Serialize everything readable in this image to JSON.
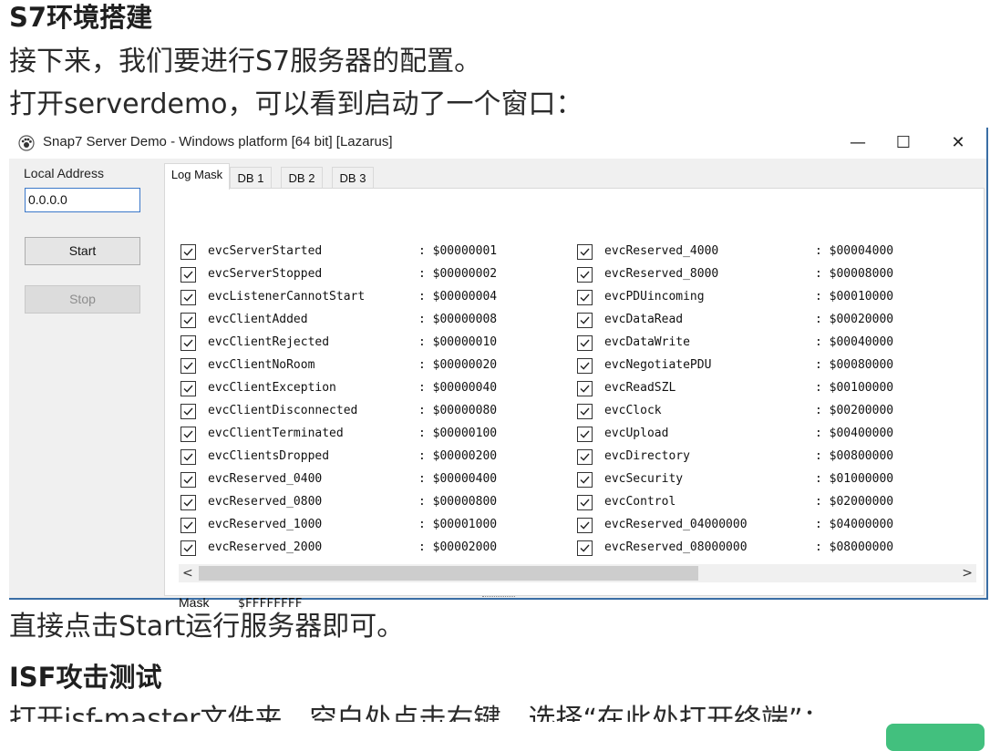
{
  "article": {
    "heading1": "S7环境搭建",
    "para1": "接下来，我们要进行S7服务器的配置。",
    "para2": "打开serverdemo，可以看到启动了一个窗口：",
    "para3": "直接点击Start运行服务器即可。",
    "heading2": "ISF攻击测试",
    "para4": "打开isf-master文件夹，空白处点击右键，选择“在此处打开终端”："
  },
  "window": {
    "title": "Snap7 Server Demo - Windows platform [64 bit] [Lazarus]",
    "minimize": "—",
    "maximize": "☐",
    "close": "✕"
  },
  "left_panel": {
    "address_label": "Local Address",
    "address_value": "0.0.0.0",
    "start_label": "Start",
    "stop_label": "Stop"
  },
  "tabs": [
    {
      "label": "Log Mask",
      "active": true
    },
    {
      "label": "DB 1",
      "active": false
    },
    {
      "label": "DB 2",
      "active": false
    },
    {
      "label": "DB 3",
      "active": false
    }
  ],
  "left_events": [
    {
      "name": "evcServerStarted",
      "value": ": $00000001",
      "checked": true
    },
    {
      "name": "evcServerStopped",
      "value": ": $00000002",
      "checked": true
    },
    {
      "name": "evcListenerCannotStart",
      "value": ": $00000004",
      "checked": true
    },
    {
      "name": "evcClientAdded",
      "value": ": $00000008",
      "checked": true
    },
    {
      "name": "evcClientRejected",
      "value": ": $00000010",
      "checked": true
    },
    {
      "name": "evcClientNoRoom",
      "value": ": $00000020",
      "checked": true
    },
    {
      "name": "evcClientException",
      "value": ": $00000040",
      "checked": true
    },
    {
      "name": "evcClientDisconnected",
      "value": ": $00000080",
      "checked": true
    },
    {
      "name": "evcClientTerminated",
      "value": ": $00000100",
      "checked": true
    },
    {
      "name": "evcClientsDropped",
      "value": ": $00000200",
      "checked": true
    },
    {
      "name": "evcReserved_0400",
      "value": ": $00000400",
      "checked": true
    },
    {
      "name": "evcReserved_0800",
      "value": ": $00000800",
      "checked": true
    },
    {
      "name": "evcReserved_1000",
      "value": ": $00001000",
      "checked": true
    },
    {
      "name": "evcReserved_2000",
      "value": ": $00002000",
      "checked": true
    }
  ],
  "right_events": [
    {
      "name": "evcReserved_4000",
      "value": ": $00004000",
      "checked": true
    },
    {
      "name": "evcReserved_8000",
      "value": ": $00008000",
      "checked": true
    },
    {
      "name": "evcPDUincoming",
      "value": ": $00010000",
      "checked": true
    },
    {
      "name": "evcDataRead",
      "value": ": $00020000",
      "checked": true
    },
    {
      "name": "evcDataWrite",
      "value": ": $00040000",
      "checked": true
    },
    {
      "name": "evcNegotiatePDU",
      "value": ": $00080000",
      "checked": true
    },
    {
      "name": "evcReadSZL",
      "value": ": $00100000",
      "checked": true
    },
    {
      "name": "evcClock",
      "value": ": $00200000",
      "checked": true
    },
    {
      "name": "evcUpload",
      "value": ": $00400000",
      "checked": true
    },
    {
      "name": "evcDirectory",
      "value": ": $00800000",
      "checked": true
    },
    {
      "name": "evcSecurity",
      "value": ": $01000000",
      "checked": true
    },
    {
      "name": "evcControl",
      "value": ": $02000000",
      "checked": true
    },
    {
      "name": "evcReserved_04000000",
      "value": ": $04000000",
      "checked": true
    },
    {
      "name": "evcReserved_08000000",
      "value": ": $08000000",
      "checked": true
    }
  ],
  "scroll": {
    "left_arrow": "<",
    "right_arrow": ">"
  },
  "mask": {
    "label": "Mask",
    "value": "$FFFFFFFF"
  }
}
